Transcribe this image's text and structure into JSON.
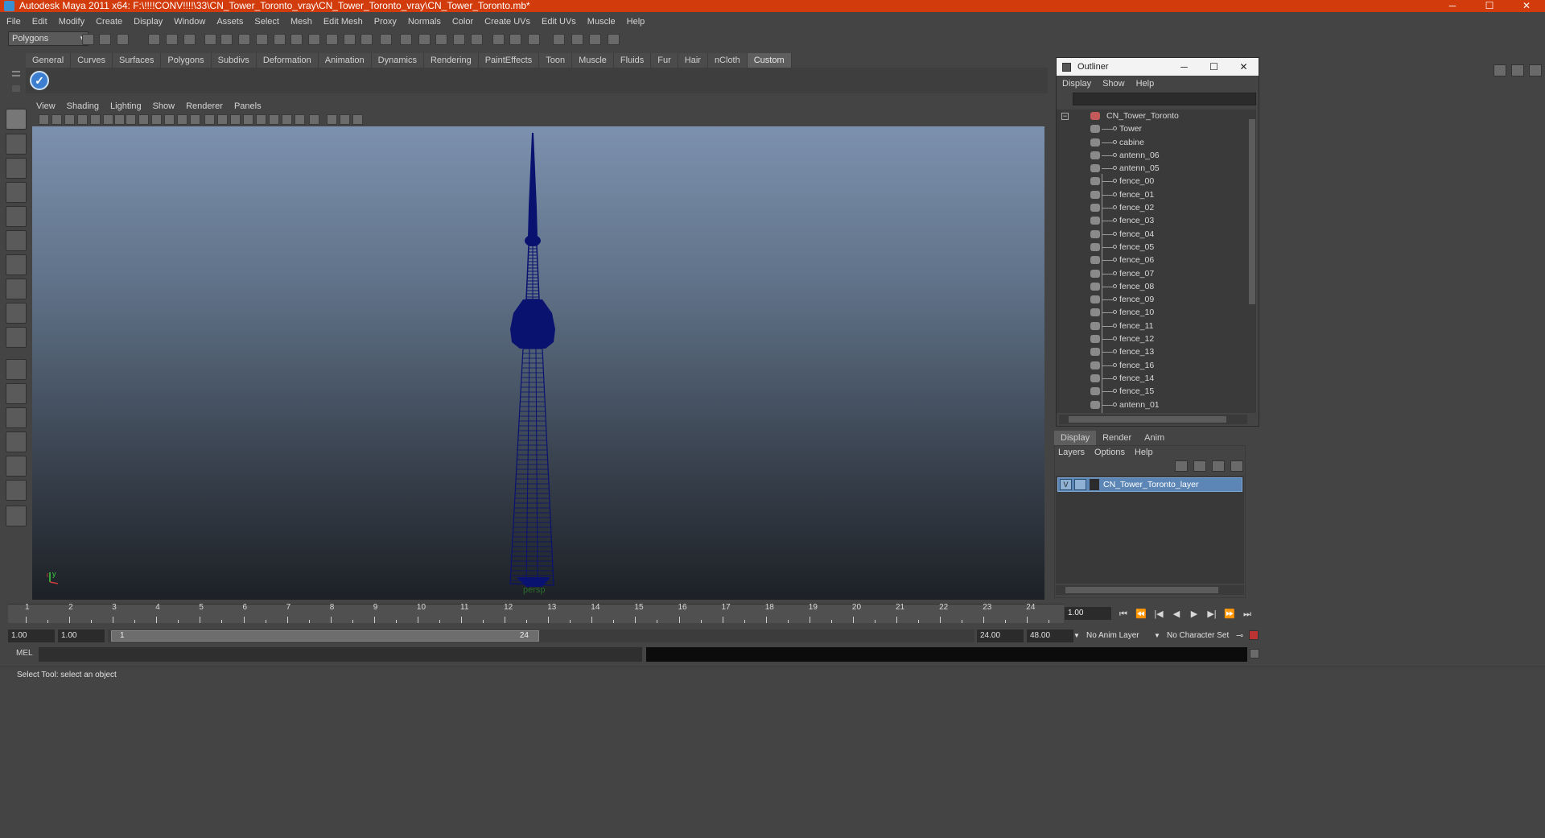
{
  "window": {
    "title": "Autodesk Maya 2011 x64: F:\\!!!!CONV!!!!\\33\\CN_Tower_Toronto_vray\\CN_Tower_Toronto_vray\\CN_Tower_Toronto.mb*",
    "minimize": "─",
    "maximize": "☐",
    "close": "✕"
  },
  "menubar": [
    "File",
    "Edit",
    "Modify",
    "Create",
    "Display",
    "Window",
    "Assets",
    "Select",
    "Mesh",
    "Edit Mesh",
    "Proxy",
    "Normals",
    "Color",
    "Create UVs",
    "Edit UVs",
    "Muscle",
    "Help"
  ],
  "statusline": {
    "mode": "Polygons"
  },
  "shelf": {
    "tabs": [
      "General",
      "Curves",
      "Surfaces",
      "Polygons",
      "Subdivs",
      "Deformation",
      "Animation",
      "Dynamics",
      "Rendering",
      "PaintEffects",
      "Toon",
      "Muscle",
      "Fluids",
      "Fur",
      "Hair",
      "nCloth",
      "Custom"
    ],
    "active_tab": "Custom",
    "icons": [
      "checkmark-icon"
    ]
  },
  "viewport": {
    "menu": [
      "View",
      "Shading",
      "Lighting",
      "Show",
      "Renderer",
      "Panels"
    ],
    "camera": "persp",
    "axis_labels": {
      "x": "x",
      "y": "y"
    },
    "wire_color": "#0a1270"
  },
  "outliner": {
    "title": "Outliner",
    "menu": [
      "Display",
      "Show",
      "Help"
    ],
    "root": "CN_Tower_Toronto",
    "items": [
      "Tower",
      "cabine",
      "antenn_06",
      "antenn_05",
      "fence_00",
      "fence_01",
      "fence_02",
      "fence_03",
      "fence_04",
      "fence_05",
      "fence_06",
      "fence_07",
      "fence_08",
      "fence_09",
      "fence_10",
      "fence_11",
      "fence_12",
      "fence_13",
      "fence_16",
      "fence_14",
      "fence_15",
      "antenn_01"
    ]
  },
  "layers": {
    "tabs": [
      "Display",
      "Render",
      "Anim"
    ],
    "active_tab": "Display",
    "menu": [
      "Layers",
      "Options",
      "Help"
    ],
    "layer_name": "CN_Tower_Toronto_layer",
    "visibility": "V"
  },
  "timeline": {
    "ticks": [
      "1",
      "2",
      "3",
      "4",
      "5",
      "6",
      "7",
      "8",
      "9",
      "10",
      "11",
      "12",
      "13",
      "14",
      "15",
      "16",
      "17",
      "18",
      "19",
      "20",
      "21",
      "22",
      "23",
      "24"
    ],
    "current_frame": "1",
    "frame_field": "1.00"
  },
  "range": {
    "start": "1.00",
    "start_inner": "1.00",
    "handle_start": "1",
    "handle_end": "24",
    "end_inner": "24.00",
    "end": "48.00",
    "anim_layer": "No Anim Layer",
    "char_set": "No Character Set"
  },
  "cmdline": {
    "label": "MEL"
  },
  "helpline": {
    "text": "Select Tool: select an object"
  }
}
